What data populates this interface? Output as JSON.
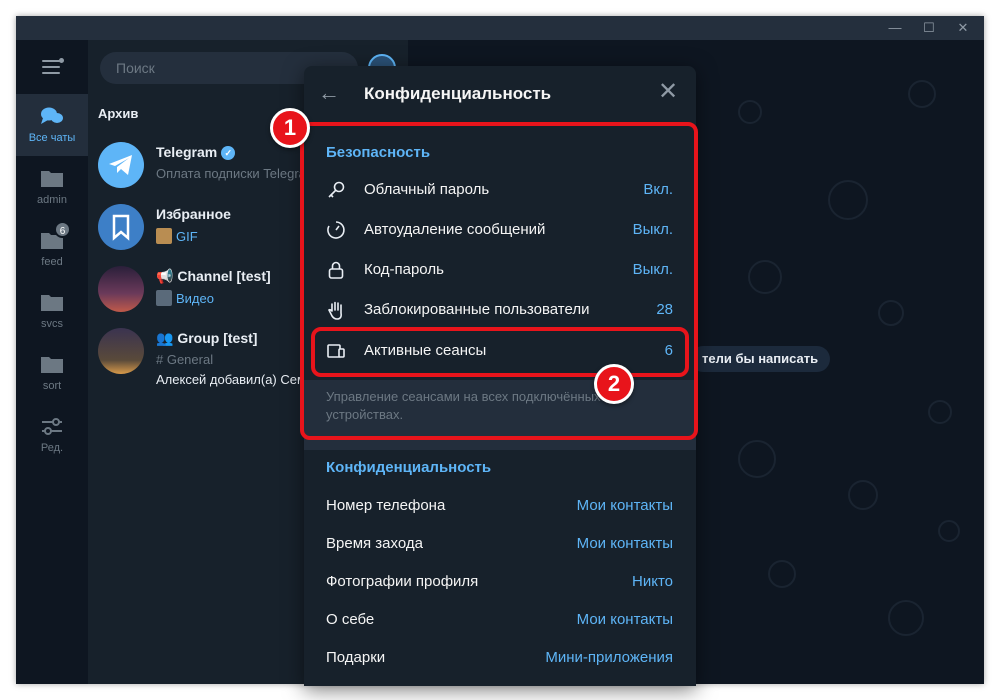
{
  "window": {
    "minimize": "—",
    "maximize": "☐",
    "close": "✕"
  },
  "folders": [
    {
      "label": "Все чаты",
      "icon": "chats-icon",
      "active": true
    },
    {
      "label": "admin",
      "icon": "folder-icon"
    },
    {
      "label": "feed",
      "icon": "folder-icon",
      "badge": "6"
    },
    {
      "label": "svcs",
      "icon": "folder-icon"
    },
    {
      "label": "sort",
      "icon": "folder-icon"
    },
    {
      "label": "Ред.",
      "icon": "edit-folders-icon"
    }
  ],
  "search": {
    "placeholder": "Поиск"
  },
  "chatlist": {
    "archive_label": "Архив",
    "chats": [
      {
        "name": "Telegram",
        "verified": true,
        "message": "Оплата подписки Telegram"
      },
      {
        "name": "Избранное",
        "message": "GIF"
      },
      {
        "name": "Channel [test]",
        "message": "Видео"
      },
      {
        "name": "Group [test]",
        "message_line1": "# General",
        "message_line2": "Алексей добавил(а) Семёна"
      }
    ]
  },
  "chat_area": {
    "empty_hint": "тели бы написать"
  },
  "privacy_panel": {
    "back_icon": "←",
    "title": "Конфиденциальность",
    "close_icon": "✕",
    "security": {
      "header": "Безопасность",
      "items": [
        {
          "label": "Облачный пароль",
          "value": "Вкл.",
          "icon": "key-icon"
        },
        {
          "label": "Автоудаление сообщений",
          "value": "Выкл.",
          "icon": "timer-icon"
        },
        {
          "label": "Код-пароль",
          "value": "Выкл.",
          "icon": "lock-icon"
        },
        {
          "label": "Заблокированные пользователи",
          "value": "28",
          "icon": "hand-icon"
        },
        {
          "label": "Активные сеансы",
          "value": "6",
          "icon": "devices-icon"
        }
      ],
      "description": "Управление сеансами на всех подключённых устройствах."
    },
    "privacy": {
      "header": "Конфиденциальность",
      "items": [
        {
          "label": "Номер телефона",
          "value": "Мои контакты"
        },
        {
          "label": "Время захода",
          "value": "Мои контакты"
        },
        {
          "label": "Фотографии профиля",
          "value": "Никто"
        },
        {
          "label": "О себе",
          "value": "Мои контакты"
        },
        {
          "label": "Подарки",
          "value": "Мини-приложения"
        }
      ]
    }
  },
  "annotations": {
    "marker_1": "1",
    "marker_2": "2",
    "color": "#e8141b"
  }
}
